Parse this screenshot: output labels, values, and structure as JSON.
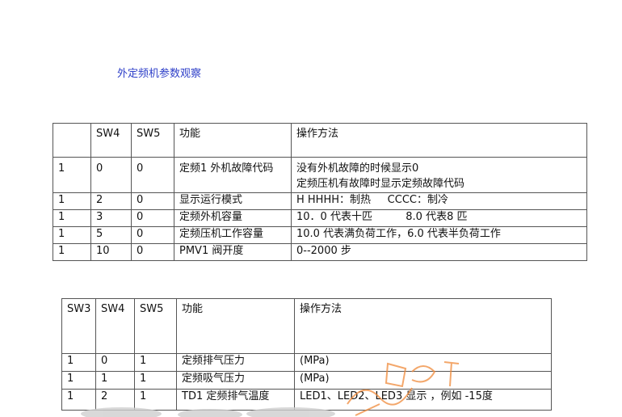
{
  "title": "外定频机参数观察",
  "table1": {
    "headers": [
      "",
      "SW4",
      "SW5",
      "功能",
      "操作方法"
    ],
    "rows": [
      {
        "c1": "1",
        "c2": "0",
        "c3": "0",
        "c4": "定频1 外机故障代码",
        "c5a": "没有外机故障的时候显示0",
        "c5b": "定频压机有故障时显示定频故障代码"
      },
      {
        "c1": "1",
        "c2": "2",
        "c3": "0",
        "c4": "显示运行模式",
        "c5": "H HHHH：制热     CCCC：制冷"
      },
      {
        "c1": "1",
        "c2": "3",
        "c3": "0",
        "c4": "定频外机容量",
        "c5": "10．0 代表十匹          8.0 代表8 匹"
      },
      {
        "c1": "1",
        "c2": "5",
        "c3": "0",
        "c4": "定频压机工作容量",
        "c5": "10.0 代表满负荷工作，6.0 代表半负荷工作"
      },
      {
        "c1": "1",
        "c2": "10",
        "c3": "0",
        "c4": "PMV1 阀开度",
        "c5": "0--2000 步"
      }
    ]
  },
  "table2": {
    "headers": [
      "SW3",
      "SW4",
      "SW5",
      "功能",
      "操作方法"
    ],
    "rows": [
      {
        "c1": "1",
        "c2": "0",
        "c3": "1",
        "c4": "定频排气压力",
        "c5": "(MPa)"
      },
      {
        "c1": "1",
        "c2": "1",
        "c3": "1",
        "c4": "定频吸气压力",
        "c5": "(MPa)"
      },
      {
        "c1": "1",
        "c2": "2",
        "c3": "1",
        "c4": "TD1 定频排气温度",
        "c5": "LED1、LED2、LED3 显示 ，例如 -15度"
      }
    ]
  },
  "colors": {
    "title": "#2d3ec8",
    "border": "#555555",
    "watermark": "#f08a3a"
  }
}
